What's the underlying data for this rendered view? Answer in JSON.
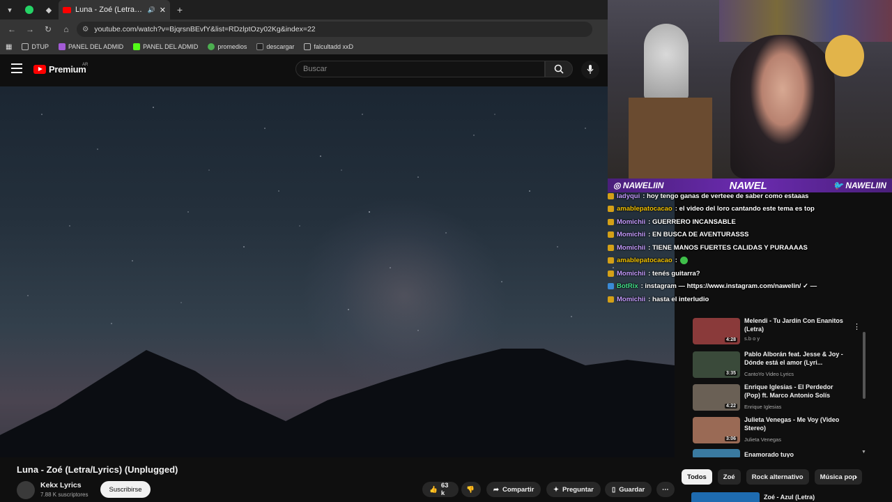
{
  "browser": {
    "tab_title": "Luna - Zoé (Letra/Lyrics) (U",
    "url": "youtube.com/watch?v=BjqrsnBEvfY&list=RDzlptOzy02Kg&index=22",
    "bookmarks": [
      "DTUP",
      "PANEL DEL ADMID",
      "PANEL DEL ADMID",
      "promedios",
      "descargar",
      "falcultadd xxD"
    ]
  },
  "youtube": {
    "brand": "Premium",
    "country": "AR",
    "search_placeholder": "Buscar"
  },
  "video": {
    "title": "Luna - Zoé (Letra/Lyrics) (Unplugged)",
    "channel": "Kekx Lyrics",
    "subscribers": "7.88 K suscriptores",
    "subscribe_label": "Suscribirse",
    "likes": "63 k",
    "share_label": "Compartir",
    "ask_label": "Preguntar",
    "save_label": "Guardar"
  },
  "playlist": [
    {
      "title": "Melendi - Tu Jardín Con Enanitos (Letra)",
      "channel": "s.b o y",
      "duration": "4:28",
      "color": "#8a3a3a"
    },
    {
      "title": "Pablo Alborán feat. Jesse & Joy - Dónde está el amor (Lyri...",
      "channel": "CantoYo Video Lyrics",
      "duration": "3:35",
      "color": "#3a4a3a"
    },
    {
      "title": "Enrique Iglesias - El Perdedor (Pop) ft. Marco Antonio Solís",
      "channel": "Enrique Iglesias",
      "duration": "4:22",
      "color": "#6a6055"
    },
    {
      "title": "Julieta Venegas - Me Voy (Video Stereo)",
      "channel": "Julieta Venegas",
      "duration": "3:06",
      "color": "#9a6a55"
    },
    {
      "title": "Enamorado tuyo",
      "channel": "",
      "duration": "",
      "color": "#3a7aa0"
    }
  ],
  "chips": [
    "Todos",
    "Zoé",
    "Rock alternativo",
    "Música pop"
  ],
  "next_video": "Zoé - Azul (Letra)",
  "stream": {
    "handle_left": "NAWELIIN",
    "name_center": "NAWEL",
    "handle_right": "NAWELIIN"
  },
  "chat": [
    {
      "user": "ladyqui",
      "msg": ": hoy tengo ganas de verteee de saber como estaaas",
      "color": "purple"
    },
    {
      "user": "amablepatocacao",
      "msg": ": el video del loro cantando este tema es top",
      "color": "yellow"
    },
    {
      "user": "Momichii",
      "msg": ": GUERRERO INCANSABLE",
      "color": "purple"
    },
    {
      "user": "Momichii",
      "msg": ": EN BUSCA DE AVENTURASSS",
      "color": "purple"
    },
    {
      "user": "Momichii",
      "msg": ": TIENE MANOS FUERTES CALIDAS Y PURAAAAS",
      "color": "purple"
    },
    {
      "user": "amablepatocacao",
      "msg": ":",
      "color": "yellow"
    },
    {
      "user": "Momichii",
      "msg": ": tenés guitarra?",
      "color": "purple"
    },
    {
      "user": "BotRix",
      "msg": ": instagram — https://www.instagram.com/nawelin/ ✓ —",
      "color": "green"
    },
    {
      "user": "Momichii",
      "msg": ": hasta el interludio",
      "color": "purple"
    }
  ]
}
